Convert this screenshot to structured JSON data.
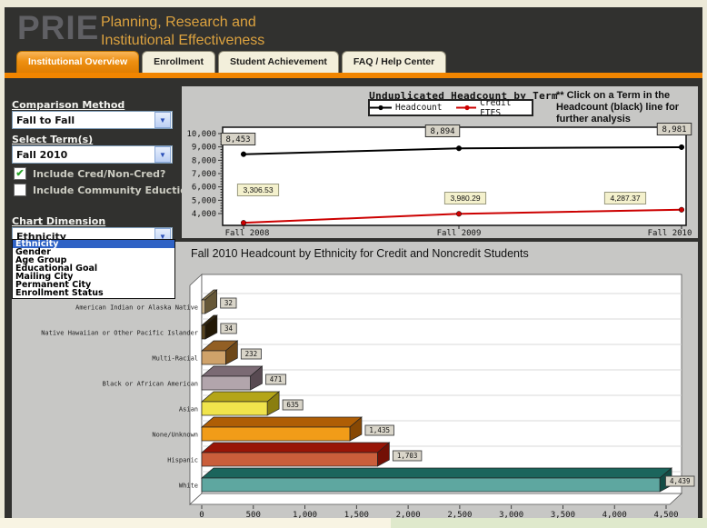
{
  "header": {
    "logo": "PRIE",
    "subtitle_line1": "Planning, Research and",
    "subtitle_line2": "Institutional Effectiveness"
  },
  "tabs": [
    {
      "label": "Institutional Overview",
      "active": true
    },
    {
      "label": "Enrollment",
      "active": false
    },
    {
      "label": "Student Achievement",
      "active": false
    },
    {
      "label": "FAQ / Help Center",
      "active": false
    }
  ],
  "accent_colors": {
    "orange_bar": "#f18500",
    "active_tab": "#ee9012",
    "selection_blue": "#2f62c5",
    "check_green": "#2ea52e"
  },
  "sidebar": {
    "comparison_method": {
      "label": "Comparison Method",
      "value": "Fall to Fall"
    },
    "select_terms": {
      "label": "Select Term(s)",
      "value": "Fall 2010"
    },
    "include_cred": {
      "label": "Include Cred/Non-Cred?",
      "checked": true
    },
    "include_community": {
      "label": "Include Community Eduction?",
      "checked": false
    },
    "chart_dimension": {
      "label": "Chart Dimension",
      "value": "Ethnicity",
      "selected_index": 0,
      "options": [
        "Ethnicity",
        "Gender",
        "Age Group",
        "Educational Goal",
        "Mailing City",
        "Permanent City",
        "Enrollment Status"
      ]
    }
  },
  "chart_data": [
    {
      "type": "line",
      "title": "Unduplicated Headcount by Term",
      "annotation": "** Click on a Term in the Headcount (black) line for further analysis",
      "categories": [
        "Fall 2008",
        "Fall 2009",
        "Fall 2010"
      ],
      "series": [
        {
          "name": "Headcount",
          "color": "#000000",
          "values": [
            8453,
            8894,
            8981
          ],
          "labels": [
            "8,453",
            "8,894",
            "8,981"
          ]
        },
        {
          "name": "Credit FTES",
          "color": "#cc0000",
          "values": [
            3306.53,
            3980.29,
            4287.37
          ],
          "labels": [
            "3,306.53",
            "3,980.29",
            "4,287.37"
          ]
        }
      ],
      "ylim": [
        4000,
        10000
      ],
      "ytick_step": 1000,
      "yticks": [
        "4,000",
        "5,000",
        "6,000",
        "7,000",
        "8,000",
        "9,000",
        "10,000"
      ],
      "grid": false,
      "legend_position": "top"
    },
    {
      "type": "bar",
      "orientation": "horizontal",
      "style": "3d",
      "title": "Fall 2010 Headcount by Ethnicity for Credit and Noncredit Students",
      "categories": [
        "American Indian or Alaska Native",
        "Native Hawaiian or Other Pacific Islander",
        "Multi-Racial",
        "Black or African American",
        "Asian",
        "None/Unknown",
        "Hispanic",
        "White"
      ],
      "values": [
        32,
        34,
        232,
        471,
        635,
        1435,
        1703,
        4439
      ],
      "labels": [
        "32",
        "34",
        "232",
        "471",
        "635",
        "1,435",
        "1,703",
        "4,439"
      ],
      "bar_colors": [
        {
          "front": "#c9b48c",
          "top": "#8a784e",
          "side": "#665838"
        },
        {
          "front": "#5a4620",
          "top": "#33260c",
          "side": "#221806"
        },
        {
          "front": "#cfa26a",
          "top": "#925f24",
          "side": "#6d4718"
        },
        {
          "front": "#b2a5ac",
          "top": "#7b6a74",
          "side": "#584a52"
        },
        {
          "front": "#f0e44c",
          "top": "#b4a518",
          "side": "#8a7e10"
        },
        {
          "front": "#f19c18",
          "top": "#af5e05",
          "side": "#874804"
        },
        {
          "front": "#ca5e3b",
          "top": "#981507",
          "side": "#731005"
        },
        {
          "front": "#5ea7a0",
          "top": "#1b655c",
          "side": "#134c45"
        }
      ],
      "xlim": [
        0,
        4500
      ],
      "xticks": [
        "0",
        "500",
        "1,000",
        "1,500",
        "2,000",
        "2,500",
        "3,000",
        "3,500",
        "4,000",
        "4,500"
      ],
      "grid": true
    }
  ]
}
